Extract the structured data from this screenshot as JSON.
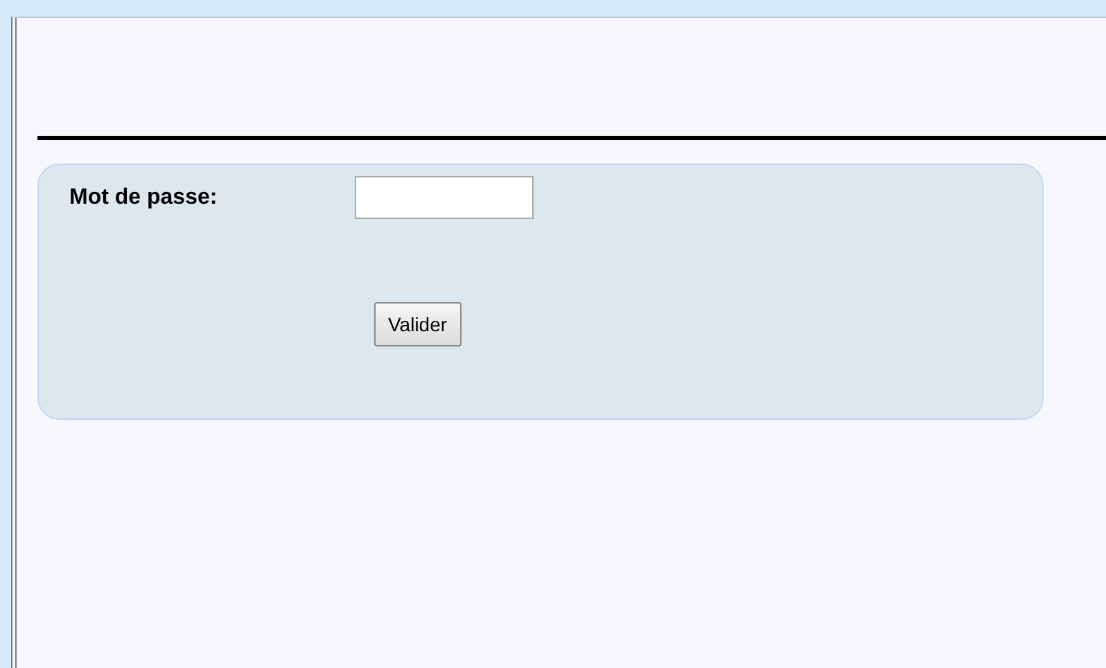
{
  "login_form": {
    "password_label": "Mot de passe:",
    "submit_button": "Valider"
  }
}
